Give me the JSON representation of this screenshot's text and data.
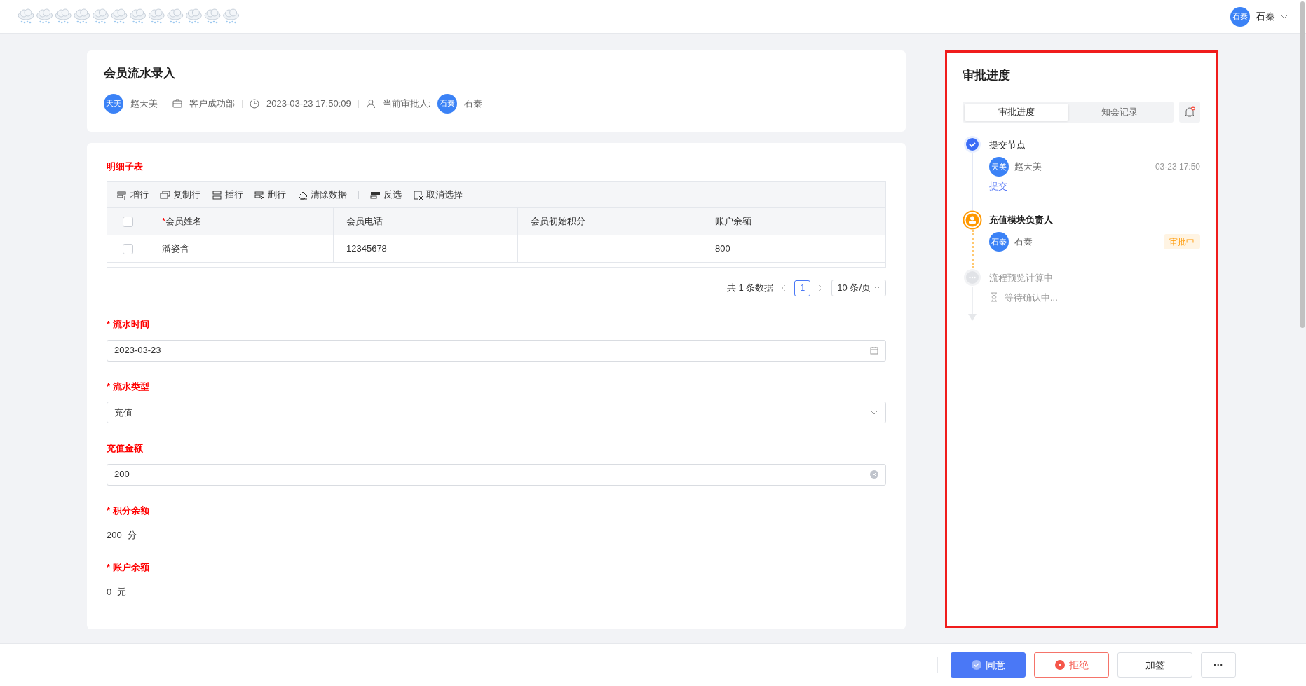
{
  "topbar": {
    "user": {
      "avatar": "石秦",
      "name": "石秦"
    }
  },
  "header": {
    "title": "会员流水录入",
    "submitter": {
      "avatar": "天美",
      "name": "赵天美"
    },
    "department": "客户成功部",
    "time": "2023-03-23 17:50:09",
    "approver_label": "当前审批人:",
    "approver": {
      "avatar": "石秦",
      "name": "石秦"
    }
  },
  "subtable": {
    "title": "明细子表",
    "toolbar": [
      {
        "kind": "add",
        "label": "增行"
      },
      {
        "kind": "copy",
        "label": "复制行"
      },
      {
        "kind": "insert",
        "label": "插行"
      },
      {
        "kind": "delete",
        "label": "删行"
      },
      {
        "kind": "clear",
        "label": "清除数据"
      },
      {
        "kind": "invert",
        "label": "反选"
      },
      {
        "kind": "deselect",
        "label": "取消选择"
      }
    ],
    "columns": [
      {
        "label": "会员姓名",
        "marker": "*"
      },
      {
        "label": "会员电话"
      },
      {
        "label": "会员初始积分"
      },
      {
        "label": "账户余额"
      }
    ],
    "rows": [
      {
        "checked": false,
        "cells": [
          "潘姿含",
          "12345678",
          "",
          "800"
        ]
      }
    ],
    "header_checked": false,
    "pagination": {
      "total": "共 1 条数据",
      "page": "1",
      "page_size": "10 条/页"
    }
  },
  "fields": [
    {
      "kind": "date",
      "marker": "*",
      "label": "流水时间",
      "value": "2023-03-23"
    },
    {
      "kind": "select",
      "marker": "*",
      "label": "流水类型",
      "value": "充值"
    },
    {
      "kind": "input",
      "label": "充值金额",
      "value": "200"
    },
    {
      "kind": "text",
      "marker": "*",
      "label": "积分余额",
      "value": "200",
      "unit": "分"
    },
    {
      "kind": "text",
      "marker": "*",
      "label": "账户余额",
      "value": "0",
      "unit": "元"
    }
  ],
  "approval": {
    "title": "审批进度",
    "tabs": [
      {
        "label": "审批进度",
        "selected": true
      },
      {
        "label": "知会记录",
        "selected": false
      }
    ],
    "steps": [
      {
        "kind": "done",
        "title": "提交节点",
        "user": {
          "avatar": "天美",
          "name": "赵天美"
        },
        "time": "03-23 17:50",
        "action": "提交"
      },
      {
        "kind": "current",
        "title": "充值模块负责人",
        "user": {
          "avatar": "石秦",
          "name": "石秦"
        },
        "status": "审批中"
      },
      {
        "kind": "pending",
        "title": "流程预览计算中",
        "note": "等待确认中..."
      }
    ]
  },
  "footer": {
    "buttons": [
      {
        "kind": "primary",
        "label": "同意"
      },
      {
        "kind": "danger",
        "label": "拒绝"
      },
      {
        "kind": "default",
        "label": "加签"
      },
      {
        "kind": "more",
        "label": "···"
      }
    ]
  }
}
